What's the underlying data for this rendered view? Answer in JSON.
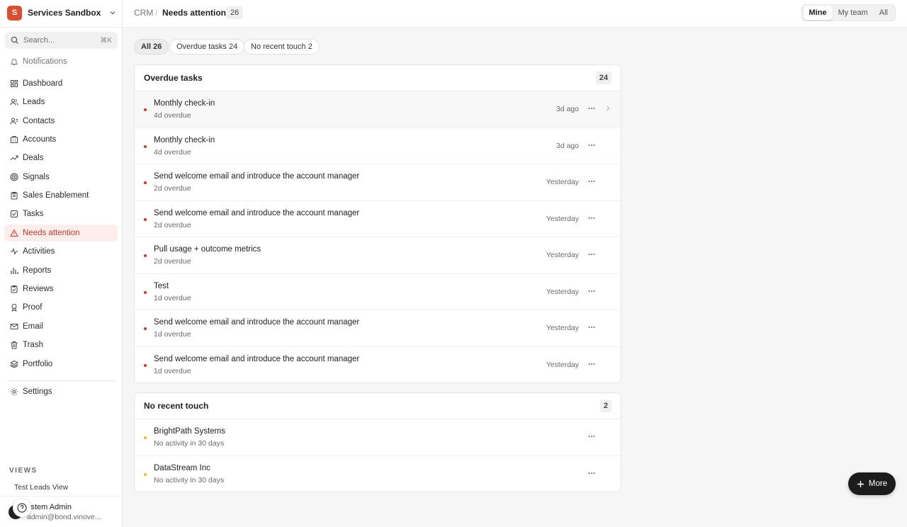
{
  "workspace": {
    "initial": "S",
    "name": "Services Sandbox",
    "logo_color": "#d9502f"
  },
  "search": {
    "placeholder": "Search...",
    "shortcut": "⌘K"
  },
  "sidebar": {
    "notifications": "Notifications",
    "items": [
      {
        "label": "Dashboard",
        "icon": "grid-icon"
      },
      {
        "label": "Leads",
        "icon": "users-icon"
      },
      {
        "label": "Contacts",
        "icon": "contact-icon"
      },
      {
        "label": "Accounts",
        "icon": "building-icon"
      },
      {
        "label": "Deals",
        "icon": "trend-icon"
      },
      {
        "label": "Signals",
        "icon": "signal-icon"
      },
      {
        "label": "Sales Enablement",
        "icon": "clipboard-icon"
      },
      {
        "label": "Tasks",
        "icon": "checkbox-icon"
      },
      {
        "label": "Needs attention",
        "icon": "warning-icon",
        "active": true
      },
      {
        "label": "Activities",
        "icon": "pulse-icon"
      },
      {
        "label": "Reports",
        "icon": "bar-chart-icon"
      },
      {
        "label": "Reviews",
        "icon": "clipboard-check-icon"
      },
      {
        "label": "Proof",
        "icon": "award-icon"
      },
      {
        "label": "Email",
        "icon": "mail-icon"
      },
      {
        "label": "Trash",
        "icon": "trash-icon"
      },
      {
        "label": "Portfolio",
        "icon": "layers-icon"
      }
    ],
    "settings": "Settings",
    "views_label": "VIEWS",
    "views": [
      "Test Leads View"
    ],
    "user": {
      "name": "ystem Admin",
      "email": "admin@bond.vinove..."
    }
  },
  "breadcrumb": {
    "root": "CRM",
    "separator": "/",
    "current": "Needs attention",
    "count": "26"
  },
  "scope": {
    "options": [
      "Mine",
      "My team",
      "All"
    ],
    "selected": "Mine"
  },
  "filters": [
    "All 26",
    "Overdue tasks 24",
    "No recent touch 2"
  ],
  "overdue": {
    "title": "Overdue tasks",
    "count": "24",
    "rows": [
      {
        "title": "Monthly check-in",
        "sub": "4d overdue",
        "time": "3d ago"
      },
      {
        "title": "Monthly check-in",
        "sub": "4d overdue",
        "time": "3d ago"
      },
      {
        "title": "Send welcome email and introduce the account manager",
        "sub": "2d overdue",
        "time": "Yesterday"
      },
      {
        "title": "Send welcome email and introduce the account manager",
        "sub": "2d overdue",
        "time": "Yesterday"
      },
      {
        "title": "Pull usage + outcome metrics",
        "sub": "2d overdue",
        "time": "Yesterday"
      },
      {
        "title": "Test",
        "sub": "1d overdue",
        "time": "Yesterday"
      },
      {
        "title": "Send welcome email and introduce the account manager",
        "sub": "1d overdue",
        "time": "Yesterday"
      },
      {
        "title": "Send welcome email and introduce the account manager",
        "sub": "1d overdue",
        "time": "Yesterday"
      }
    ]
  },
  "norecent": {
    "title": "No recent touch",
    "count": "2",
    "rows": [
      {
        "title": "BrightPath Systems",
        "sub": "No activity in 30 days"
      },
      {
        "title": "DataStream Inc",
        "sub": "No activity in 30 days"
      }
    ]
  },
  "fab": {
    "label": "More"
  },
  "colors": {
    "accent": "#c43b2a",
    "active_bg": "#fbeeec",
    "overdue_dot": "#d0342c",
    "stale_dot": "#e8b931"
  }
}
